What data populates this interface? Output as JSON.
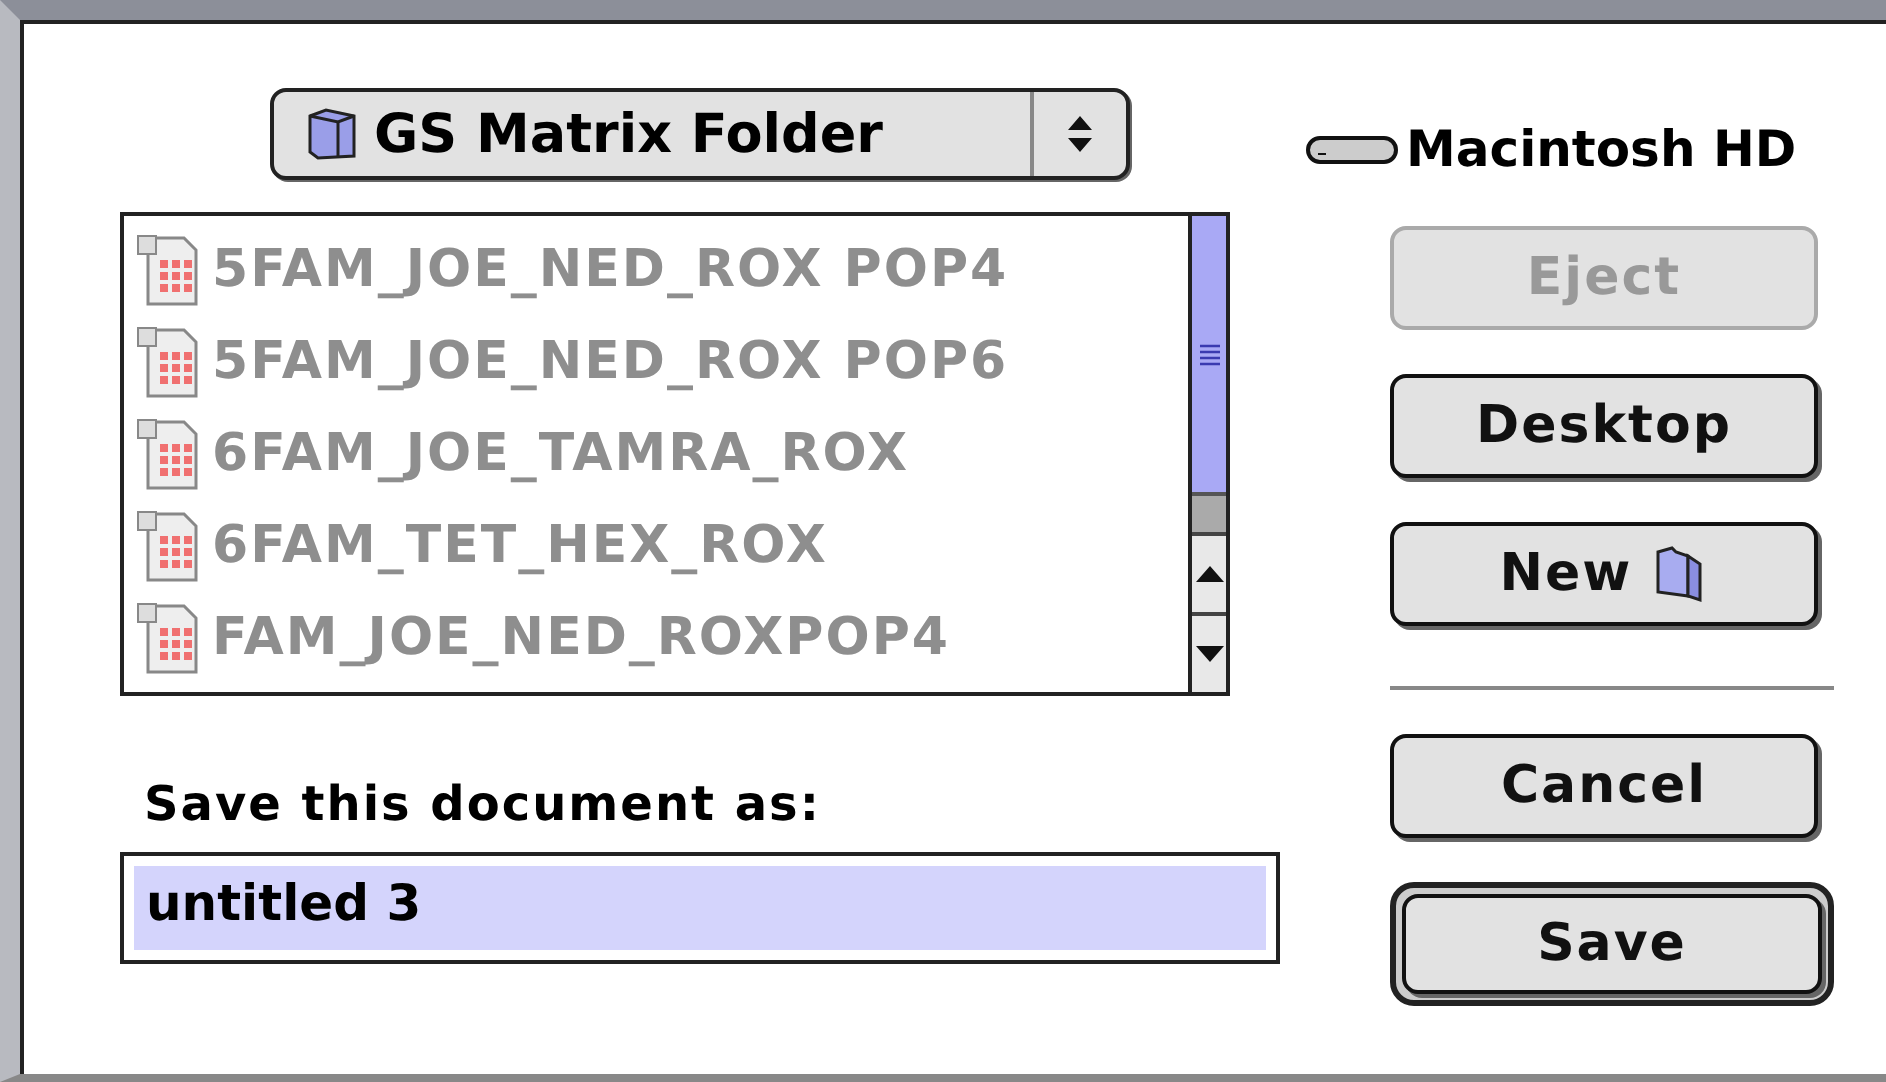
{
  "folder_menu": {
    "label": "GS Matrix Folder"
  },
  "volume": {
    "label": "Macintosh HD"
  },
  "files": [
    {
      "name": "5FAM_JOE_NED_ROX POP4",
      "dimmed": true
    },
    {
      "name": "5FAM_JOE_NED_ROX POP6",
      "dimmed": true
    },
    {
      "name": "6FAM_JOE_TAMRA_ROX",
      "dimmed": true
    },
    {
      "name": "6FAM_TET_HEX_ROX",
      "dimmed": true
    },
    {
      "name": "FAM_JOE_NED_ROXPOP4",
      "dimmed": true
    }
  ],
  "buttons": [
    {
      "label": "Eject",
      "kind": "plain",
      "disabled": true
    },
    {
      "label": "Desktop",
      "kind": "plain",
      "disabled": false
    },
    {
      "label": "New",
      "kind": "folder",
      "disabled": false
    },
    {
      "label": "Cancel",
      "kind": "plain",
      "disabled": false
    },
    {
      "label": "Save",
      "kind": "default",
      "disabled": false
    }
  ],
  "name_field": {
    "label": "Save this document as:",
    "value": "untitled 3",
    "selected": true
  }
}
